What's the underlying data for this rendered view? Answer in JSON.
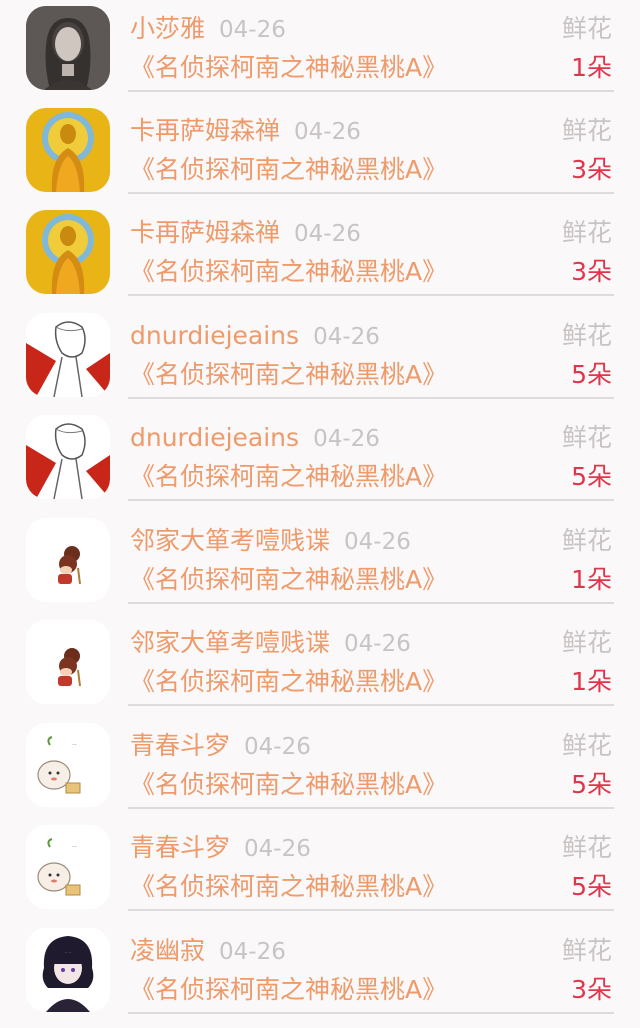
{
  "records": [
    {
      "user": "小莎雅",
      "date": "04-26",
      "book": "《名侦探柯南之神秘黑桃A》",
      "gift": "鲜花",
      "count": "1朵",
      "avatar": "avatar-portrait-woman"
    },
    {
      "user": "卡再萨姆森禅",
      "date": "04-26",
      "book": "《名侦探柯南之神秘黑桃A》",
      "gift": "鲜花",
      "count": "3朵",
      "avatar": "avatar-golden-buddha"
    },
    {
      "user": "卡再萨姆森禅",
      "date": "04-26",
      "book": "《名侦探柯南之神秘黑桃A》",
      "gift": "鲜花",
      "count": "3朵",
      "avatar": "avatar-golden-buddha"
    },
    {
      "user": "dnurdiejeains",
      "date": "04-26",
      "book": "《名侦探柯南之神秘黑桃A》",
      "gift": "鲜花",
      "count": "5朵",
      "avatar": "avatar-anime-sketch"
    },
    {
      "user": "dnurdiejeains",
      "date": "04-26",
      "book": "《名侦探柯南之神秘黑桃A》",
      "gift": "鲜花",
      "count": "5朵",
      "avatar": "avatar-anime-sketch"
    },
    {
      "user": "邻家大箪考噎贱谍",
      "date": "04-26",
      "book": "《名侦探柯南之神秘黑桃A》",
      "gift": "鲜花",
      "count": "1朵",
      "avatar": "avatar-cartoon-girl"
    },
    {
      "user": "邻家大箪考噎贱谍",
      "date": "04-26",
      "book": "《名侦探柯南之神秘黑桃A》",
      "gift": "鲜花",
      "count": "1朵",
      "avatar": "avatar-cartoon-girl"
    },
    {
      "user": "青春斗穸",
      "date": "04-26",
      "book": "《名侦探柯南之神秘黑桃A》",
      "gift": "鲜花",
      "count": "5朵",
      "avatar": "avatar-sprout-blob"
    },
    {
      "user": "青春斗穸",
      "date": "04-26",
      "book": "《名侦探柯南之神秘黑桃A》",
      "gift": "鲜花",
      "count": "5朵",
      "avatar": "avatar-sprout-blob"
    },
    {
      "user": "凌幽寂",
      "date": "04-26",
      "book": "《名侦探柯南之神秘黑桃A》",
      "gift": "鲜花",
      "count": "3朵",
      "avatar": "avatar-anime-boy"
    }
  ],
  "colors": {
    "accent": "#ee9a6a",
    "count": "#e0364c",
    "muted": "#c8c4c4",
    "background": "#fbf8f9"
  }
}
